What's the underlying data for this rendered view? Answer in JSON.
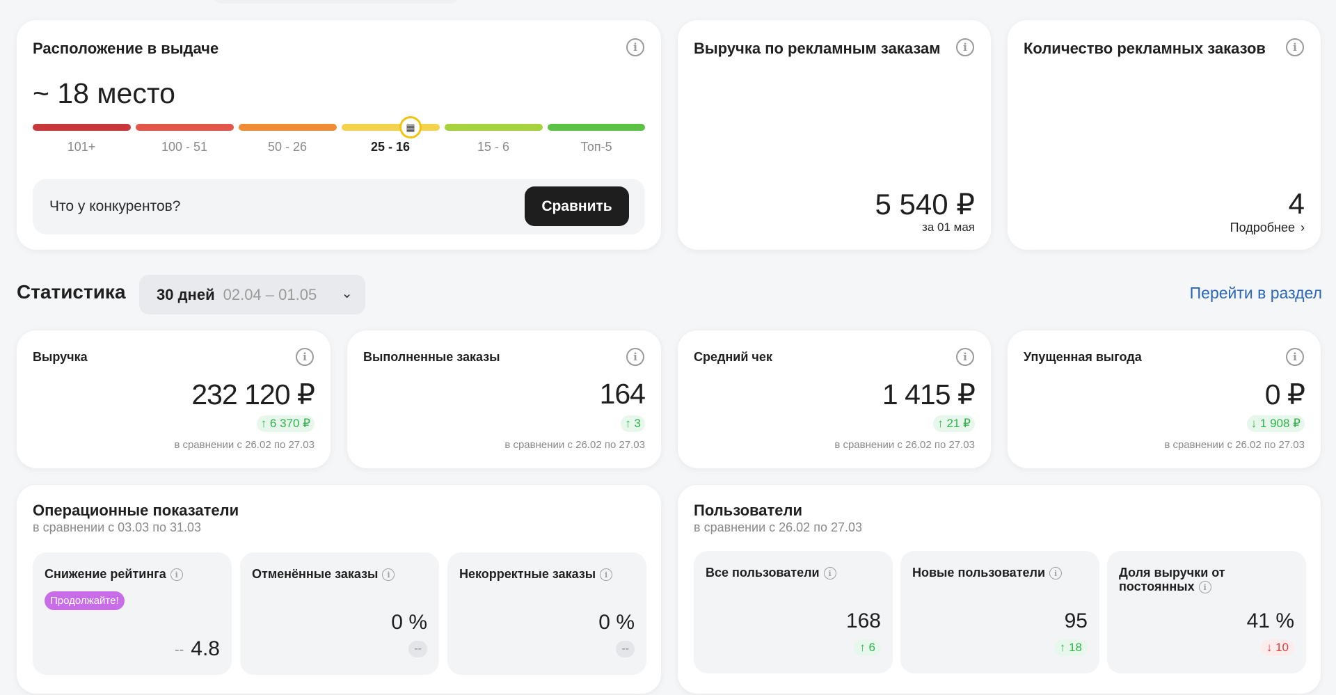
{
  "position_card": {
    "title": "Расположение в выдаче",
    "value": "~ 18 место",
    "segments": [
      {
        "label": "101+",
        "color": "#c8373a",
        "active": false
      },
      {
        "label": "100 - 51",
        "color": "#e2574a",
        "active": false
      },
      {
        "label": "50 - 26",
        "color": "#ef8c35",
        "active": false
      },
      {
        "label": "25 - 16",
        "color": "#f3d24e",
        "active": true
      },
      {
        "label": "15 - 6",
        "color": "#a6d33d",
        "active": false
      },
      {
        "label": "Топ-5",
        "color": "#5cc245",
        "active": false
      }
    ],
    "compare_question": "Что у конкурентов?",
    "compare_button": "Сравнить"
  },
  "ad_revenue_card": {
    "title": "Выручка по рекламным заказам",
    "value": "5 540 ₽",
    "subtitle": "за 01 мая"
  },
  "ad_orders_card": {
    "title": "Количество рекламных заказов",
    "value": "4",
    "more_link": "Подробнее"
  },
  "statistics": {
    "title": "Статистика",
    "period_days": "30 дней",
    "period_dates": "02.04 – 01.05",
    "goto_link": "Перейти в раздел",
    "cards": [
      {
        "title": "Выручка",
        "value": "232 120 ₽",
        "delta": "↑ 6 370 ₽",
        "delta_type": "up",
        "compare": "в сравнении с 26.02 по 27.03"
      },
      {
        "title": "Выполненные заказы",
        "value": "164",
        "delta": "↑ 3",
        "delta_type": "up",
        "compare": "в сравнении с 26.02 по 27.03"
      },
      {
        "title": "Средний чек",
        "value": "1 415 ₽",
        "delta": "↑ 21 ₽",
        "delta_type": "up",
        "compare": "в сравнении с 26.02 по 27.03"
      },
      {
        "title": "Упущенная выгода",
        "value": "0 ₽",
        "delta": "↓ 1 908 ₽",
        "delta_type": "down",
        "compare": "в сравнении с 26.02 по 27.03"
      }
    ]
  },
  "operational": {
    "title": "Операционные показатели",
    "subtitle": "в сравнении с 03.03 по 31.03",
    "rating_drop": {
      "title": "Снижение рейтинга",
      "badge": "Продолжайте!",
      "dash": "--",
      "value": "4.8"
    },
    "cancelled": {
      "title": "Отменённые заказы",
      "value": "0 %",
      "dash": "--"
    },
    "incorrect": {
      "title": "Некорректные заказы",
      "value": "0 %",
      "dash": "--"
    }
  },
  "users": {
    "title": "Пользователи",
    "subtitle": "в сравнении с 26.02 по 27.03",
    "all": {
      "title": "Все пользователи",
      "value": "168",
      "delta": "↑ 6"
    },
    "new": {
      "title": "Новые пользователи",
      "value": "95",
      "delta": "↑ 18"
    },
    "returning": {
      "title": "Доля выручки от постоянных",
      "value": "41 %",
      "delta": "↓ 10"
    }
  }
}
